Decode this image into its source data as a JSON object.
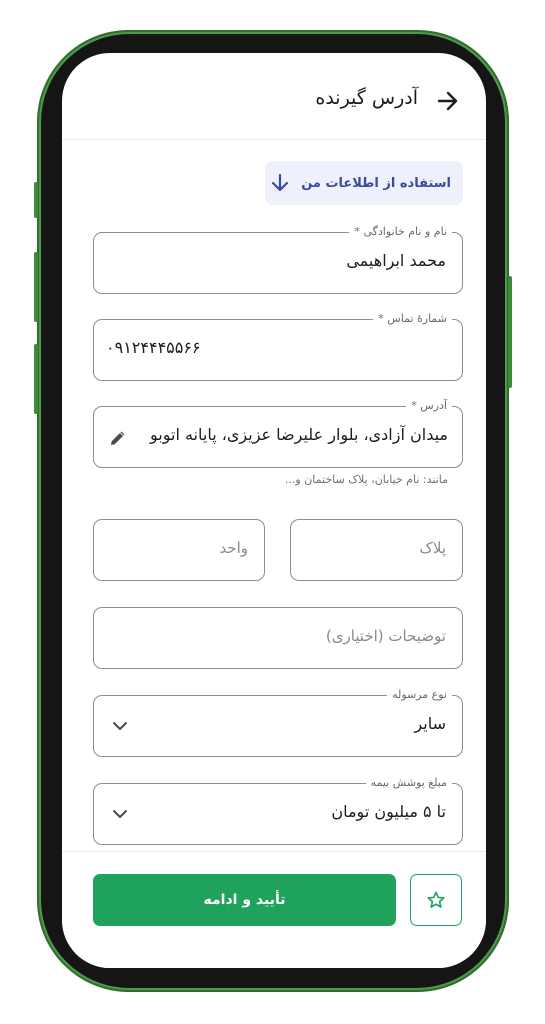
{
  "header": {
    "title": "آدرس گیرنده",
    "back_icon": "arrow-right-icon"
  },
  "use_my_info": {
    "label": "استفاده از اطلاعات من",
    "icon": "arrow-down-icon"
  },
  "form": {
    "full_name": {
      "label": "نام و نام خانوادگی *",
      "value": "محمد ابراهیمی"
    },
    "phone": {
      "label": "شمارهٔ تماس *",
      "value": "۰۹۱۲۴۴۴۵۵۶۶"
    },
    "address": {
      "label": "آدرس *",
      "value": "میدان آزادی، بلوار علیرضا عزیزی، پایانه اتوبو",
      "helper": "مانند: نام خیابان، پلاک ساختمان و..."
    },
    "plate": {
      "placeholder": "پلاک"
    },
    "unit": {
      "placeholder": "واحد"
    },
    "description": {
      "placeholder": "توضیحات (اختیاری)"
    },
    "package_type": {
      "label": "نوع مرسوله",
      "value": "سایر"
    },
    "insurance": {
      "label": "مبلغ پوشش بیمه",
      "value": "تا ۵ میلیون تومان"
    }
  },
  "footer": {
    "confirm_label": "تأیید و ادامه",
    "favorite_icon": "star-icon"
  },
  "colors": {
    "accent": "#1fa35c",
    "frame": "#4f9a4a",
    "info_bg": "#eef0fb",
    "info_text": "#3c4a9e"
  }
}
